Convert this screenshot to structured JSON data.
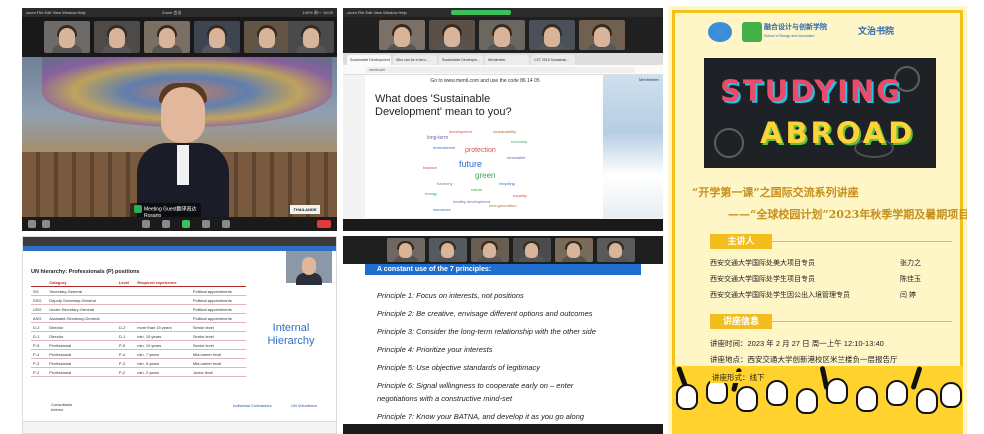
{
  "panel1": {
    "menubar_left": "zoom  File  Edit  View  Window  Help",
    "window_title": "Zoom 会议",
    "menubar_right": "100% 周一 10:09",
    "speaker_badge": "Meeting Guest翻译直达",
    "speaker_badge_sub": "Rosario",
    "sign_text": "THAILANDE"
  },
  "panel2": {
    "tabs": [
      "Sustainable Development",
      "Who can be a hero...",
      "Sustainable Developm...",
      "Mentimeter",
      "CST 2016 Sustainab..."
    ],
    "address": "menti.com",
    "goto_line": "Go to www.menti.com and use the code 86 14 05",
    "question": "What does 'Sustainable Development' mean to you?",
    "brand": "Mentimeter",
    "words": [
      {
        "text": "protection",
        "size": 7,
        "color": "#d9534f"
      },
      {
        "text": "future",
        "size": 9,
        "color": "#2a6fc9"
      },
      {
        "text": "green",
        "size": 8,
        "color": "#3aa655"
      },
      {
        "text": "long-term",
        "size": 5,
        "color": "#7a5ab0"
      },
      {
        "text": "sustainability",
        "size": 4,
        "color": "#b0723a"
      },
      {
        "text": "environment",
        "size": 4,
        "color": "#2a6fc9"
      },
      {
        "text": "economy",
        "size": 4,
        "color": "#3aa655"
      },
      {
        "text": "balance",
        "size": 4,
        "color": "#d9534f"
      },
      {
        "text": "renewable",
        "size": 4,
        "color": "#7a5ab0"
      },
      {
        "text": "harmony",
        "size": 4,
        "color": "#b0723a"
      },
      {
        "text": "recycling",
        "size": 4,
        "color": "#2a6fc9"
      },
      {
        "text": "energy",
        "size": 4,
        "color": "#3aa655"
      },
      {
        "text": "equality",
        "size": 4,
        "color": "#d9534f"
      },
      {
        "text": "healthy development",
        "size": 4,
        "color": "#7a5ab0"
      },
      {
        "text": "next generation",
        "size": 4,
        "color": "#b0723a"
      },
      {
        "text": "resources",
        "size": 4,
        "color": "#2a6fc9"
      },
      {
        "text": "nature",
        "size": 4,
        "color": "#3aa655"
      },
      {
        "text": "development",
        "size": 4,
        "color": "#d9534f"
      }
    ]
  },
  "panel3": {
    "logo1_line1": "融合设计与创新学院",
    "logo1_line2": "School of Design and Innovation",
    "logo2": "文治书院",
    "banner_line1": "STUDYING",
    "banner_line2": "ABROAD",
    "title1": "“开学第一课”之国际交流系列讲座",
    "title2": "——“全球校园计划”2023年秋季学期及暑期项目",
    "speakers_heading": "主讲人",
    "speakers": [
      {
        "role": "西安交通大学国际处美大项目专员",
        "name": "张力之"
      },
      {
        "role": "西安交通大学国际处学生项目专员",
        "name": "陈佳玉"
      },
      {
        "role": "西安交通大学国际处学生因公出入境管理专员",
        "name": "闫  婷"
      }
    ],
    "info_heading": "讲座信息",
    "info": [
      "讲座时间：2023 年 2 月 27 日    周一上午    12:10-13:40",
      "讲座地点：西安交通大学创新港校区米兰楼负一层报告厅",
      "讲座形式：线下"
    ]
  },
  "panel4": {
    "title": "UN hierarchy: Professionals (P) positions",
    "columns": [
      "",
      "Category",
      "Level",
      "Required experience",
      ""
    ],
    "rows": [
      [
        "SG",
        "Secretary-General",
        "",
        "",
        "Political appointments"
      ],
      [
        "DSG",
        "Deputy Secretary-General",
        "",
        "",
        "Political appointments"
      ],
      [
        "USG",
        "Under-Secretary-General",
        "",
        "",
        "Political appointments"
      ],
      [
        "ASG",
        "Assistant-Secretary-General",
        "",
        "",
        "Political appointments"
      ],
      [
        "D-2",
        "Director",
        "D-2",
        "more than 15 years",
        "Senior level"
      ],
      [
        "D-1",
        "Director",
        "D-1",
        "min. 15 years",
        "Senior level"
      ],
      [
        "P-5",
        "Professional",
        "P-5",
        "min. 10 years",
        "Senior level"
      ],
      [
        "P-4",
        "Professional",
        "P-4",
        "min. 7 years",
        "Mid-career level"
      ],
      [
        "P-3",
        "Professional",
        "P-3",
        "min. 5 years",
        "Mid-career level"
      ],
      [
        "P-2",
        "Professional",
        "P-2",
        "min. 2 years",
        "Junior level"
      ]
    ],
    "side_title": "Internal Hierarchy",
    "consultants": "Consultants",
    "interns": "Interns",
    "footer_left": "Individual Contractors",
    "footer_right": "UN Volunteers"
  },
  "panel5": {
    "header": "A constant use of the 7 principles:",
    "principles": [
      "Principle 1: Focus on interests, not positions",
      "Principle 2: Be creative, envisage different options and outcomes",
      "Principle 3: Consider the long-term relationship with the other side",
      "Principle 4: Prioritize your interests",
      "Principle 5: Use objective standards of legitimacy",
      "Principle 6: Signal willingness to cooperate early on – enter",
      "negotiations with a constructive mind-set",
      "Principle 7: Know your BATNA, and develop it as you go along"
    ]
  }
}
